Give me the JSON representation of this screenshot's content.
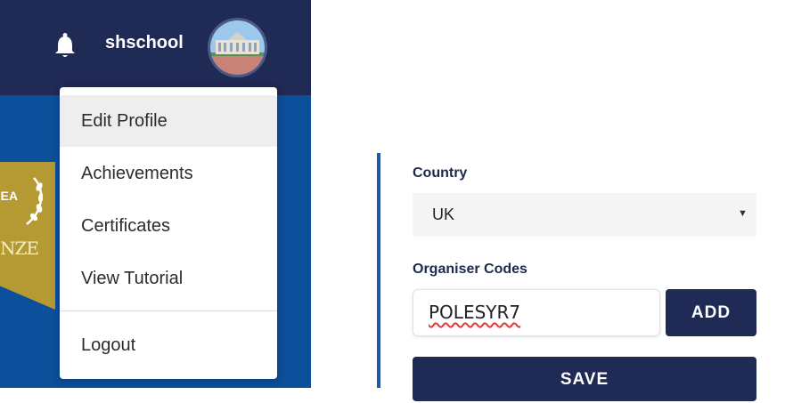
{
  "header": {
    "username": "shschool",
    "notification_icon": "bell-icon",
    "avatar_icon": "school-building-avatar",
    "background_color": "#1f2a55"
  },
  "badge": {
    "text_a": "EA",
    "text_b": "NZE",
    "color": "#b59a34"
  },
  "profile_menu": {
    "items": [
      {
        "label": "Edit Profile",
        "active": true
      },
      {
        "label": "Achievements",
        "active": false
      },
      {
        "label": "Certificates",
        "active": false
      },
      {
        "label": "View Tutorial",
        "active": false
      },
      {
        "label": "Logout",
        "active": false
      }
    ]
  },
  "form": {
    "country_label": "Country",
    "country_value": "UK",
    "organiser_codes_label": "Organiser Codes",
    "organiser_code_value": "POLESYR7",
    "add_label": "ADD",
    "save_label": "SAVE",
    "accent_color": "#1f2a55"
  }
}
